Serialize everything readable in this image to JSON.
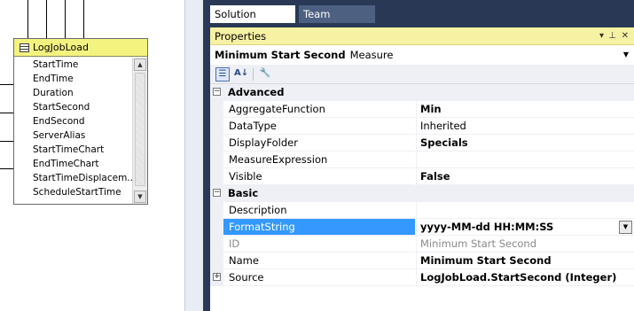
{
  "diagram": {
    "table": {
      "name": "LogJobLoad",
      "columns": [
        "StartTime",
        "EndTime",
        "Duration",
        "StartSecond",
        "EndSecond",
        "ServerAlias",
        "StartTimeChart",
        "EndTimeChart",
        "StartTimeDisplacem...",
        "ScheduleStartTime"
      ]
    }
  },
  "tabs": [
    {
      "label": "Solution Explorer",
      "active": true
    },
    {
      "label": "Team Explorer",
      "active": false
    }
  ],
  "properties": {
    "title": "Properties",
    "title_buttons": [
      "▾",
      "⊥",
      "✕"
    ],
    "object": {
      "name": "Minimum Start Second",
      "type": "Measure"
    },
    "categories": [
      {
        "name": "Advanced",
        "items": [
          {
            "name": "AggregateFunction",
            "value": "Min"
          },
          {
            "name": "DataType",
            "value": "Inherited"
          },
          {
            "name": "DisplayFolder",
            "value": "Specials"
          },
          {
            "name": "MeasureExpression",
            "value": ""
          },
          {
            "name": "Visible",
            "value": "False"
          }
        ]
      },
      {
        "name": "Basic",
        "items": [
          {
            "name": "Description",
            "value": ""
          },
          {
            "name": "FormatString",
            "value": "yyyy-MM-dd HH:MM:SS"
          },
          {
            "name": "ID",
            "value": "Minimum Start Second"
          },
          {
            "name": "Name",
            "value": "Minimum Start Second"
          },
          {
            "name": "Source",
            "value": "LogJobLoad.StartSecond (Integer)"
          }
        ]
      }
    ]
  },
  "colors": {
    "accent_title": "#f7f2a3",
    "selection": "#3399ff",
    "dark_panel": "#293955",
    "table_header": "#f5f380"
  }
}
